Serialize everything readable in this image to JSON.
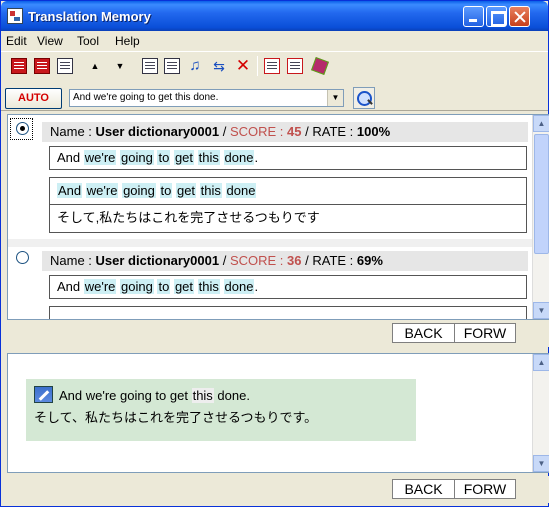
{
  "window": {
    "title": "Translation Memory"
  },
  "menu": [
    "Edit",
    "View",
    "Tool",
    "Help"
  ],
  "toolbar": {
    "up_glyph": "▲",
    "down_glyph": "▼",
    "delete_glyph": "✕"
  },
  "search": {
    "auto_label": "AUTO",
    "value": "And we're going to get this done."
  },
  "results": [
    {
      "selected": true,
      "name_label": "Name : ",
      "name": "User dictionary0001",
      "score_label": "SCORE : ",
      "score": "45",
      "rate_label": "RATE : ",
      "rate": "100%",
      "source": [
        "And ",
        "we're",
        " ",
        "going",
        " ",
        "to",
        " ",
        "get",
        " ",
        "this",
        " ",
        "done",
        "."
      ],
      "pair_source": [
        "And",
        " ",
        "we're",
        " ",
        "going",
        " ",
        "to",
        " ",
        "get",
        " ",
        "this",
        " ",
        "done"
      ],
      "pair_target": "そして,私たちはこれを完了させるつもりです"
    },
    {
      "selected": false,
      "name_label": "Name : ",
      "name": "User dictionary0001",
      "score_label": "SCORE : ",
      "score": "36",
      "rate_label": "RATE : ",
      "rate": "69%",
      "source": [
        "And ",
        "we're",
        " ",
        "going",
        " ",
        "to",
        " ",
        "get",
        " ",
        "this",
        " ",
        "done",
        "."
      ]
    }
  ],
  "nav": {
    "back": "BACK",
    "forward": "FORW"
  },
  "preview": {
    "source_parts": [
      "And we're going to get ",
      "this",
      " done."
    ],
    "target": "そして、私たちはこれを完了させるつもりです。"
  },
  "colors": {
    "title_bar": "#0a4fd8",
    "highlight": "#cdeff4",
    "score": "#c0504d",
    "preview_bg": "#d4e8d4"
  },
  "icons": [
    "app-icon",
    "red-grid-icon",
    "up-arrow-icon",
    "down-arrow-icon",
    "list-icon",
    "form-icon",
    "music-note-icon",
    "replace-icon",
    "delete-icon",
    "window-icon",
    "grid-icon",
    "book-icon",
    "search-icon",
    "pencil-icon"
  ]
}
